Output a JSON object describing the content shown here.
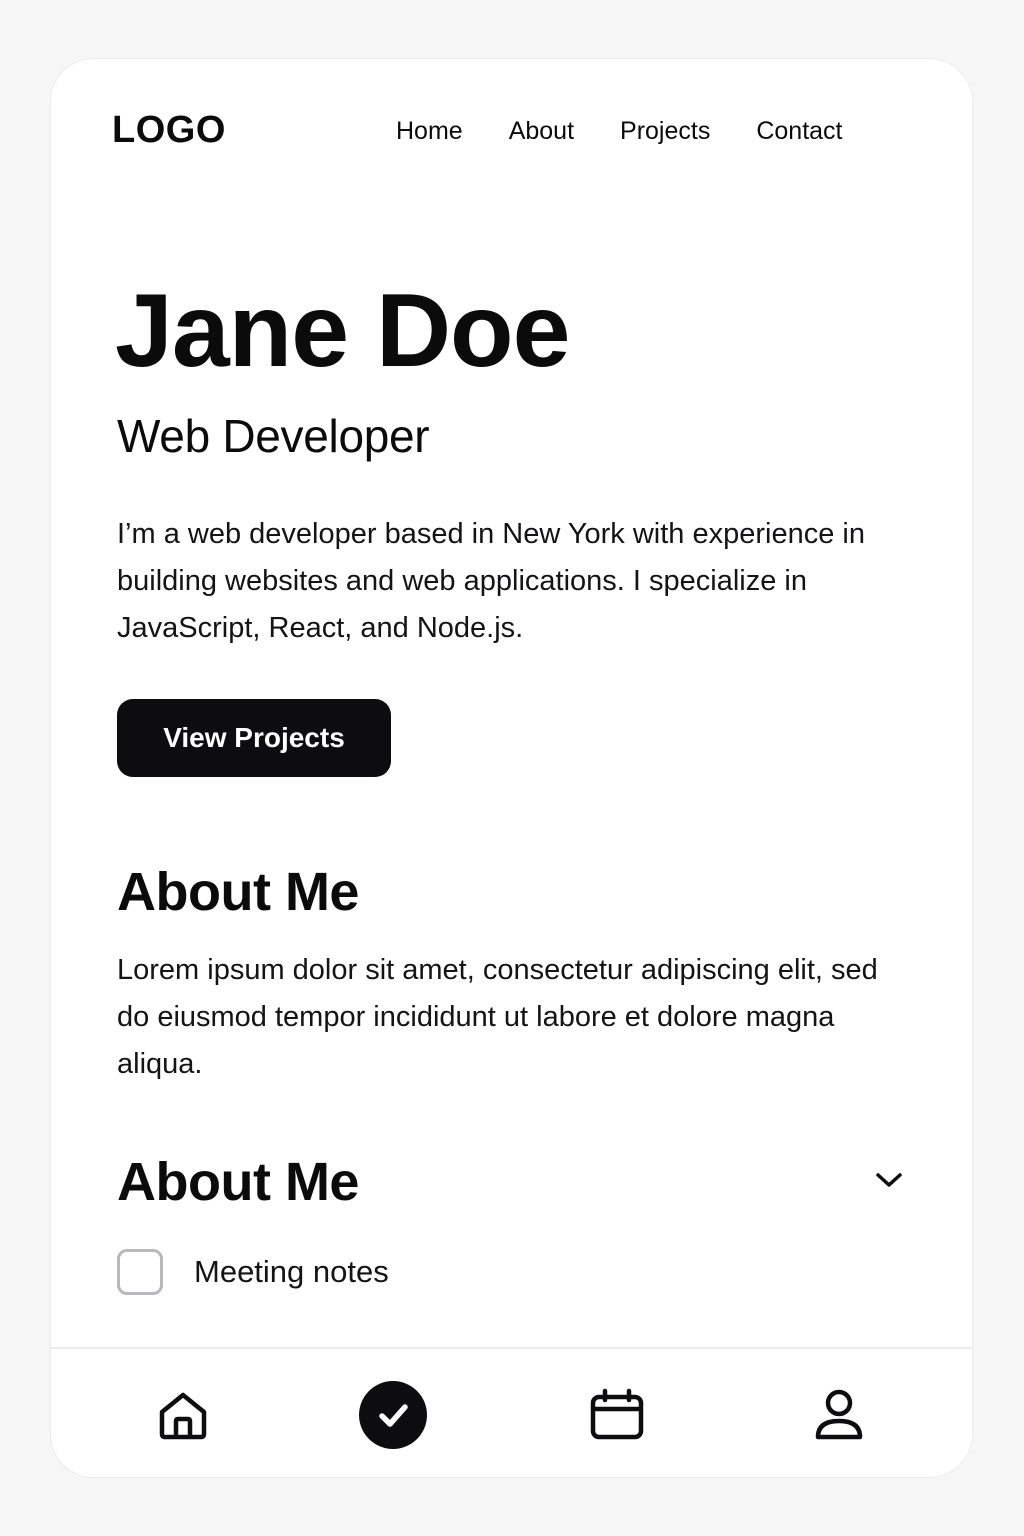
{
  "header": {
    "logo": "LOGO",
    "nav": [
      "Home",
      "About",
      "Projects",
      "Contact"
    ]
  },
  "hero": {
    "name": "Jane Doe",
    "role": "Web Developer",
    "description": "I’m a web developer based in New York with experience in building websites and web applications. I specialize in JavaScript, React, and Node.js.",
    "cta_label": "View Projects"
  },
  "about": {
    "title": "About Me",
    "body": "Lorem ipsum dolor sit amet, consectetur adipiscing elit, sed do eiusmod tempor incididunt ut labore et dolore magna aliqua."
  },
  "collapsible": {
    "title": "About Me",
    "chevron_icon": "chevron-down-icon",
    "checkbox_label": "Meeting notes",
    "checkbox_checked": false
  },
  "tabbar": {
    "items": [
      {
        "icon": "home-icon",
        "active": false
      },
      {
        "icon": "check-circle-icon",
        "active": true
      },
      {
        "icon": "calendar-icon",
        "active": false
      },
      {
        "icon": "user-icon",
        "active": false
      }
    ]
  },
  "colors": {
    "accent": "#0d0d0f",
    "background": "#f6f6f6",
    "card": "#ffffff"
  }
}
